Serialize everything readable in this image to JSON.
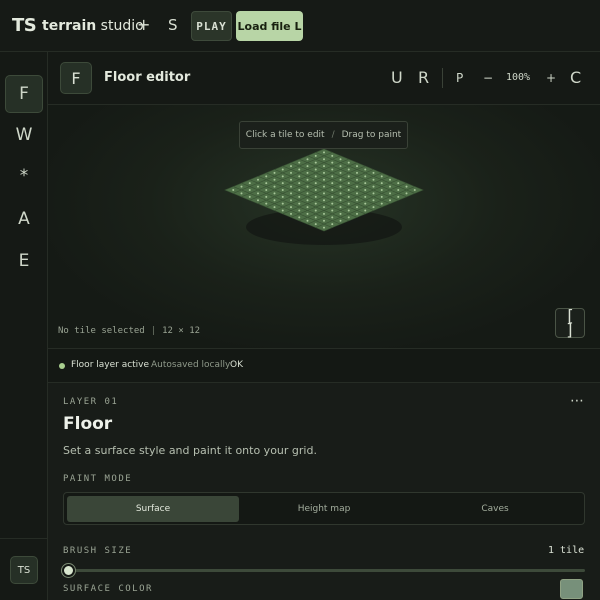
{
  "topbar": {
    "brand_mark": "TS",
    "brand_bold": "terrain",
    "brand_rest": " studio",
    "add_label": "+",
    "s_label": "S",
    "play_label": "PLAY",
    "load_label": "Load file L"
  },
  "rail": {
    "items": [
      "F",
      "W",
      "*",
      "A",
      "E"
    ],
    "active_index": 0,
    "avatar": "TS"
  },
  "editor": {
    "badge": "F",
    "title": "Floor editor",
    "tools": {
      "undo": "U",
      "redo": "R",
      "pan": "P",
      "zoom_out": "−",
      "zoom_level": "100%",
      "zoom_in": "+",
      "center": "C"
    }
  },
  "canvas": {
    "hint_click": "Click a tile to edit",
    "hint_sep": "/",
    "hint_drag": "Drag to paint",
    "selection": "No tile selected",
    "grid_size": "12 × 12",
    "grid_n": 12,
    "tile_color": "#4d6e46",
    "expand_open": "[",
    "expand_close": "]"
  },
  "status": {
    "layer": "Floor layer active",
    "save": "Autosaved locally",
    "ok": "OK",
    "dot_color": "#a9cf8f"
  },
  "panel": {
    "kicker": "LAYER 01",
    "more": "⋯",
    "title": "Floor",
    "description": "Set a surface style and paint it onto your grid.",
    "paint_mode_label": "PAINT MODE",
    "modes": [
      "Surface",
      "Height map",
      "Caves"
    ],
    "active_mode": 0,
    "brush_label": "BRUSH SIZE",
    "brush_value": "1 tile",
    "brush_fraction": 0,
    "color_label": "SURFACE COLOR",
    "surface_color": "#77907a"
  }
}
